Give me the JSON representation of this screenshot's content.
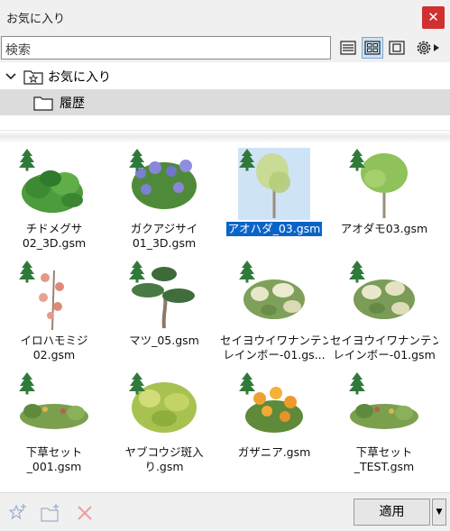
{
  "window": {
    "title": "お気に入り"
  },
  "search": {
    "placeholder": "検索"
  },
  "tree": {
    "root_label": "お気に入り",
    "child_label": "履歴"
  },
  "items": [
    {
      "line1": "チドメグサ",
      "line2": "02_3D.gsm",
      "selected": false
    },
    {
      "line1": "ガクアジサイ",
      "line2": "01_3D.gsm",
      "selected": false
    },
    {
      "line1": "アオハダ_03.gsm",
      "line2": "",
      "selected": true
    },
    {
      "line1": "アオダモ03.gsm",
      "line2": "",
      "selected": false
    },
    {
      "line1": "イロハモミジ",
      "line2": "02.gsm",
      "selected": false
    },
    {
      "line1": "マツ_05.gsm",
      "line2": "",
      "selected": false
    },
    {
      "line1": "セイヨウイワナンテン",
      "line2": "レインボー-01.gs...",
      "selected": false
    },
    {
      "line1": "セイヨウイワナンテン",
      "line2": "レインボー-01.gsm",
      "selected": false
    },
    {
      "line1": "下草セット",
      "line2": "_001.gsm",
      "selected": false
    },
    {
      "line1": "ヤブコウジ斑入",
      "line2": "り.gsm",
      "selected": false
    },
    {
      "line1": "ガザニア.gsm",
      "line2": "",
      "selected": false
    },
    {
      "line1": "下草セット",
      "line2": "_TEST.gsm",
      "selected": false
    }
  ],
  "footer": {
    "apply_label": "適用"
  },
  "colors": {
    "selection": "#0a64c8",
    "close": "#d03030",
    "tree_badge": "#2f7a3a"
  }
}
